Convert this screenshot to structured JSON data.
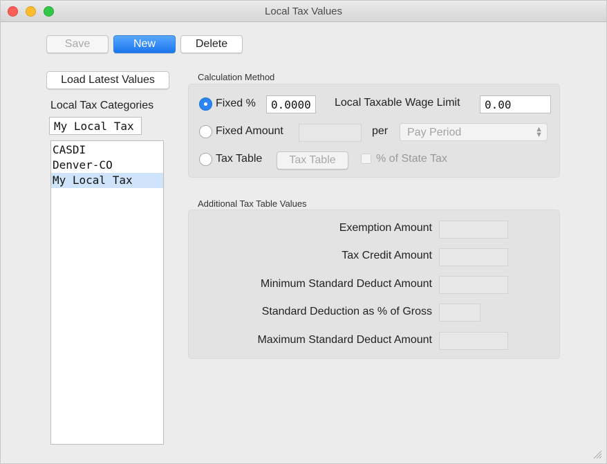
{
  "window": {
    "title": "Local Tax Values"
  },
  "toolbar": {
    "save_label": "Save",
    "new_label": "New",
    "delete_label": "Delete"
  },
  "left": {
    "load_latest_label": "Load Latest Values",
    "categories_label": "Local Tax Categories",
    "category_name_value": "My Local Tax",
    "categories": [
      "CASDI",
      "Denver-CO",
      "My Local Tax"
    ],
    "selected_index": 2
  },
  "calc": {
    "section_label": "Calculation Method",
    "fixed_percent_label": "Fixed %",
    "fixed_percent_value": "0.0000",
    "wage_limit_label": "Local Taxable Wage Limit",
    "wage_limit_value": "0.00",
    "fixed_amount_label": "Fixed Amount",
    "fixed_amount_value": "",
    "per_label": "per",
    "period_selected": "Pay Period",
    "tax_table_label": "Tax Table",
    "tax_table_button": "Tax Table",
    "percent_state_label": "% of State Tax",
    "selected_method": "Fixed %"
  },
  "additional": {
    "section_label": "Additional Tax Table Values",
    "exemption_label": "Exemption Amount",
    "tax_credit_label": "Tax Credit Amount",
    "min_std_label": "Minimum Standard Deduct Amount",
    "std_pct_label": "Standard Deduction as % of Gross",
    "max_std_label": "Maximum Standard Deduct Amount"
  },
  "icons": {
    "close": "close-button",
    "minimize": "minimize-button",
    "zoom": "zoom-button",
    "select_arrows": "chevron-up-down-icon",
    "resize": "resize-grip-icon"
  },
  "colors": {
    "accent": "#2b86f3",
    "selection": "#cfe4fb",
    "close": "#fc5f57",
    "minimize": "#fdbc2e",
    "zoom": "#33c748"
  }
}
